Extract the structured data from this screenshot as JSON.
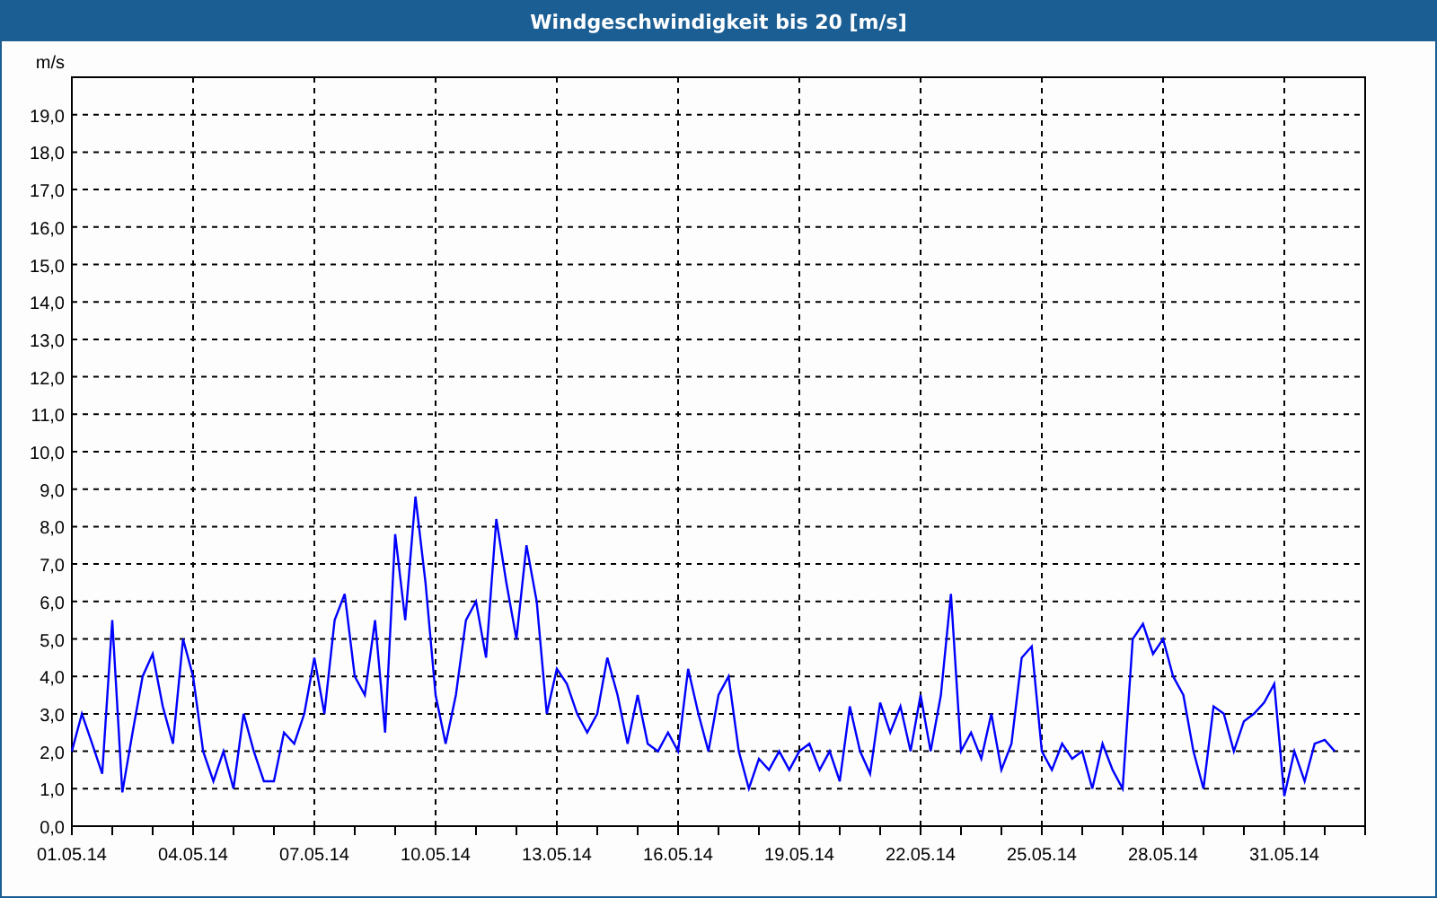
{
  "window": {
    "title": "Windgeschwindigkeit bis 20 [m/s]"
  },
  "chart": {
    "chart_data": {
      "type": "line",
      "grid": true,
      "ylabel": "m/s",
      "ylim": [
        0,
        20
      ],
      "categories": [
        "01.05.14",
        null,
        null,
        null,
        null,
        null,
        null,
        null,
        null,
        null,
        null,
        null,
        "04.05.14",
        null,
        null,
        null,
        null,
        null,
        null,
        null,
        null,
        null,
        null,
        null,
        "07.05.14",
        null,
        null,
        null,
        null,
        null,
        null,
        null,
        null,
        null,
        null,
        null,
        "10.05.14",
        null,
        null,
        null,
        null,
        null,
        null,
        null,
        null,
        null,
        null,
        null,
        "13.05.14",
        null,
        null,
        null,
        null,
        null,
        null,
        null,
        null,
        null,
        null,
        null,
        "16.05.14",
        null,
        null,
        null,
        null,
        null,
        null,
        null,
        null,
        null,
        null,
        null,
        "19.05.14",
        null,
        null,
        null,
        null,
        null,
        null,
        null,
        null,
        null,
        null,
        null,
        "22.05.14",
        null,
        null,
        null,
        null,
        null,
        null,
        null,
        null,
        null,
        null,
        null,
        "25.05.14",
        null,
        null,
        null,
        null,
        null,
        null,
        null,
        null,
        null,
        null,
        null,
        "28.05.14",
        null,
        null,
        null,
        null,
        null,
        null,
        null,
        null,
        null,
        null,
        null,
        "31.05.14",
        null,
        null,
        null,
        null,
        null
      ],
      "yticks": [
        {
          "value": 0,
          "label": "0,0"
        },
        {
          "value": 1,
          "label": "1,0"
        },
        {
          "value": 2,
          "label": "2,0"
        },
        {
          "value": 3,
          "label": "3,0"
        },
        {
          "value": 4,
          "label": "4,0"
        },
        {
          "value": 5,
          "label": "5,0"
        },
        {
          "value": 6,
          "label": "6,0"
        },
        {
          "value": 7,
          "label": "7,0"
        },
        {
          "value": 8,
          "label": "8,0"
        },
        {
          "value": 9,
          "label": "9,0"
        },
        {
          "value": 10,
          "label": "10,0"
        },
        {
          "value": 11,
          "label": "11,0"
        },
        {
          "value": 12,
          "label": "12,0"
        },
        {
          "value": 13,
          "label": "13,0"
        },
        {
          "value": 14,
          "label": "14,0"
        },
        {
          "value": 15,
          "label": "15,0"
        },
        {
          "value": 16,
          "label": "16,0"
        },
        {
          "value": 17,
          "label": "17,0"
        },
        {
          "value": 18,
          "label": "18,0"
        },
        {
          "value": 19,
          "label": "19,0"
        }
      ],
      "series": [
        {
          "color": "#0000ff",
          "values": [
            2.0,
            3.0,
            2.2,
            1.4,
            5.5,
            0.9,
            2.5,
            4.0,
            4.6,
            3.2,
            2.2,
            5.0,
            4.0,
            2.0,
            1.2,
            2.0,
            1.0,
            3.0,
            2.0,
            1.2,
            1.2,
            2.5,
            2.2,
            3.0,
            4.5,
            3.0,
            5.5,
            6.2,
            4.0,
            3.5,
            5.5,
            2.5,
            7.8,
            5.5,
            8.8,
            6.5,
            3.5,
            2.2,
            3.5,
            5.5,
            6.0,
            4.5,
            8.2,
            6.5,
            5.0,
            7.5,
            6.0,
            3.0,
            4.2,
            3.8,
            3.0,
            2.5,
            3.0,
            4.5,
            3.5,
            2.2,
            3.5,
            2.2,
            2.0,
            2.5,
            2.0,
            4.2,
            3.0,
            2.0,
            3.5,
            4.0,
            2.0,
            1.0,
            1.8,
            1.5,
            2.0,
            1.5,
            2.0,
            2.2,
            1.5,
            2.0,
            1.2,
            3.2,
            2.0,
            1.4,
            3.3,
            2.5,
            3.2,
            2.0,
            3.5,
            2.0,
            3.5,
            6.2,
            2.0,
            2.5,
            1.8,
            3.0,
            1.5,
            2.2,
            4.5,
            4.8,
            2.0,
            1.5,
            2.2,
            1.8,
            2.0,
            1.0,
            2.2,
            1.5,
            1.0,
            5.0,
            5.4,
            4.6,
            5.0,
            4.0,
            3.5,
            2.0,
            1.0,
            3.2,
            3.0,
            2.0,
            2.8,
            3.0,
            3.3,
            3.8,
            0.8,
            2.0,
            1.2,
            2.2,
            2.3,
            2.0
          ]
        }
      ]
    }
  }
}
